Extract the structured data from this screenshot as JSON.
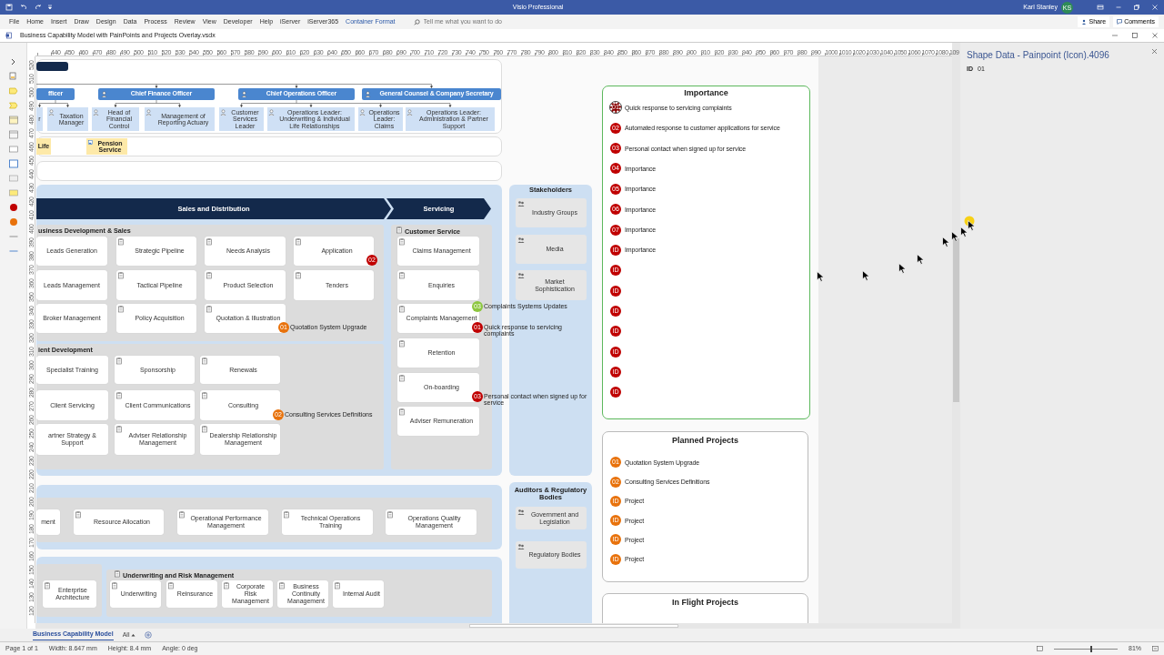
{
  "title_bar": {
    "app_title": "Visio Professional",
    "user_name": "Karl Stanley",
    "user_initials": "KS"
  },
  "ribbon_tabs": [
    {
      "label": "File",
      "kind": "tab"
    },
    {
      "label": "Home",
      "kind": "tab"
    },
    {
      "label": "Insert",
      "kind": "tab"
    },
    {
      "label": "Draw",
      "kind": "tab"
    },
    {
      "label": "Design",
      "kind": "tab"
    },
    {
      "label": "Data",
      "kind": "tab"
    },
    {
      "label": "Process",
      "kind": "tab"
    },
    {
      "label": "Review",
      "kind": "tab"
    },
    {
      "label": "View",
      "kind": "tab"
    },
    {
      "label": "Developer",
      "kind": "tab"
    },
    {
      "label": "Help",
      "kind": "tab"
    },
    {
      "label": "iServer",
      "kind": "tab"
    },
    {
      "label": "iServer365",
      "kind": "tab"
    },
    {
      "label": "Container Format",
      "kind": "contextual"
    }
  ],
  "search": {
    "placeholder": "Tell me what you want to do"
  },
  "share_label": "Share",
  "comments_label": "Comments",
  "document": {
    "title": "Business Capability Model with PainPoints and Projects Overlay.vsdx"
  },
  "rulers": {
    "horizontal": [
      "440",
      "450",
      "460",
      "470",
      "480",
      "490",
      "500",
      "510",
      "520",
      "530",
      "540",
      "550",
      "560",
      "570",
      "580",
      "590",
      "600",
      "610",
      "620",
      "630",
      "640",
      "650",
      "660",
      "670",
      "680",
      "690",
      "700",
      "710",
      "720",
      "730",
      "740",
      "750",
      "760",
      "770",
      "780",
      "790",
      "800",
      "810",
      "820",
      "830",
      "840",
      "850",
      "860",
      "870",
      "880",
      "890",
      "900",
      "910",
      "920",
      "930",
      "940",
      "950",
      "960",
      "970",
      "980",
      "990",
      "1000",
      "1010",
      "1020",
      "1030",
      "1040",
      "1050",
      "1060",
      "1070",
      "1080",
      "109"
    ],
    "vertical": [
      "520",
      "510",
      "500",
      "490",
      "480",
      "470",
      "460",
      "450",
      "440",
      "430",
      "420",
      "410",
      "400",
      "390",
      "380",
      "370",
      "360",
      "350",
      "340",
      "330",
      "320",
      "310",
      "300",
      "290",
      "280",
      "270",
      "260",
      "250",
      "240",
      "230",
      "220",
      "210",
      "200",
      "190",
      "180",
      "170",
      "160",
      "150",
      "140",
      "130",
      "120"
    ]
  },
  "diagram": {
    "org_chart": {
      "executives": [
        {
          "label": "fficer"
        },
        {
          "label": "Chief Finance Officer"
        },
        {
          "label": "Chief Operations Officer"
        },
        {
          "label": "General Counsel & Company Secretary"
        }
      ],
      "reports": [
        {
          "label": "r"
        },
        {
          "label": "Taxation Manager"
        },
        {
          "label": "Head of Financial Control"
        },
        {
          "label": "Management of Reporting Actuary"
        },
        {
          "label": "Customer Services Leader"
        },
        {
          "label": "Operations Leader: Underwriting & Individual Life Relationships"
        },
        {
          "label": "Operations Leader: Claims"
        },
        {
          "label": "Operations Leader: Administration & Partner Support"
        }
      ]
    },
    "products": [
      {
        "label": "Life"
      },
      {
        "label": "Pension Service"
      }
    ],
    "value_stages": [
      {
        "label": "Sales and Distribution"
      },
      {
        "label": "Servicing"
      }
    ],
    "capability_groups": [
      {
        "title": "usiness Development & Sales",
        "capabilities": [
          {
            "label": "Leads Generation"
          },
          {
            "label": "Strategic Pipeline"
          },
          {
            "label": "Needs Analysis"
          },
          {
            "label": "Application",
            "painpoints": [
              {
                "id": "02",
                "color": "#c00000"
              }
            ]
          },
          {
            "label": "Leads Management"
          },
          {
            "label": "Tactical Pipeline"
          },
          {
            "label": "Product Selection"
          },
          {
            "label": "Tenders"
          },
          {
            "label": "Broker Management"
          },
          {
            "label": "Policy Acquisition"
          },
          {
            "label": "Quotation & Illustration",
            "painpoints": [
              {
                "id": "01",
                "color": "#e8720c",
                "note": "Quotation System Upgrade"
              }
            ]
          }
        ]
      },
      {
        "title": "ient Development",
        "capabilities": [
          {
            "label": "Specialist Training"
          },
          {
            "label": "Sponsorship"
          },
          {
            "label": "Renewals"
          },
          {
            "label": "Client Servicing"
          },
          {
            "label": "Client Communications"
          },
          {
            "label": "Consulting",
            "painpoints": [
              {
                "id": "02",
                "color": "#e8720c",
                "note": "Consulting Services Definitions"
              }
            ]
          },
          {
            "label": "artner Strategy & Support"
          },
          {
            "label": "Adviser Relationship Management"
          },
          {
            "label": "Dealership Relationship Management"
          }
        ]
      },
      {
        "title": "Customer Service",
        "capabilities": [
          {
            "label": "Claims Management"
          },
          {
            "label": "Enquiries"
          },
          {
            "label": "Complaints Management",
            "painpoints": [
              {
                "id": "03",
                "color": "#8dc63f",
                "note": "Complaints Systems Updates"
              },
              {
                "id": "01",
                "color": "#c00000",
                "note": "Quick response to servicing complaints"
              }
            ]
          },
          {
            "label": "Retention"
          },
          {
            "label": "On-boarding",
            "painpoints": [
              {
                "id": "03",
                "color": "#c00000",
                "note": "Personal contact when signed up for service"
              }
            ]
          },
          {
            "label": "Adviser Remuneration"
          }
        ]
      },
      {
        "capabilities": [
          {
            "label": "ment"
          },
          {
            "label": "Resource Allocation"
          },
          {
            "label": "Operational Performance Management"
          },
          {
            "label": "Technical Operations Training"
          },
          {
            "label": "Operations Quality Management"
          }
        ]
      },
      {
        "capabilities": [
          {
            "label": "Enterprise Architecture"
          }
        ]
      },
      {
        "title": "Underwriting and Risk Management",
        "capabilities": [
          {
            "label": "Underwriting"
          },
          {
            "label": "Reinsurance"
          },
          {
            "label": "Corporate Risk Management"
          },
          {
            "label": "Business Continuity Management"
          },
          {
            "label": "Internal Audit"
          }
        ]
      }
    ],
    "stakeholder_columns": [
      {
        "title": "Stakeholders",
        "items": [
          {
            "label": "Industry Groups"
          },
          {
            "label": "Media"
          },
          {
            "label": "Market Sophistication"
          }
        ]
      },
      {
        "title": "Auditors & Regulatory Bodies",
        "items": [
          {
            "label": "Government and Legislation"
          },
          {
            "label": "Regulatory Bodies"
          }
        ]
      }
    ],
    "importance": {
      "title": "Importance",
      "items": [
        {
          "id": "01",
          "label": "Quick response to servicing complaints",
          "selected": true
        },
        {
          "id": "02",
          "label": "Automated response to customer applications for service",
          "selected": false
        },
        {
          "id": "03",
          "label": "Personal contact when signed up for service",
          "selected": false
        },
        {
          "id": "04",
          "label": "Importance",
          "selected": false
        },
        {
          "id": "05",
          "label": "Importance",
          "selected": false
        },
        {
          "id": "06",
          "label": "Importance",
          "selected": false
        },
        {
          "id": "07",
          "label": "Importance",
          "selected": false
        },
        {
          "id": "ID",
          "label": "Importance",
          "selected": false
        },
        {
          "id": "ID",
          "selected": false
        },
        {
          "id": "ID",
          "selected": false
        },
        {
          "id": "ID",
          "selected": false
        },
        {
          "id": "ID",
          "selected": false
        },
        {
          "id": "ID",
          "selected": false
        },
        {
          "id": "ID",
          "selected": false
        },
        {
          "id": "ID",
          "selected": false
        }
      ]
    },
    "planned_projects": {
      "title": "Planned Projects",
      "items": [
        {
          "id": "01",
          "label": "Quotation System Upgrade"
        },
        {
          "id": "02",
          "label": "Consulting Services Definitions"
        },
        {
          "id": "ID",
          "label": "Project"
        },
        {
          "id": "ID",
          "label": "Project"
        },
        {
          "id": "ID",
          "label": "Project"
        },
        {
          "id": "ID",
          "label": "Project"
        }
      ]
    },
    "in_flight_projects": {
      "title": "In Flight Projects"
    }
  },
  "shape_data": {
    "title": "Shape Data - Painpoint (Icon).4096",
    "fields": [
      {
        "label": "ID",
        "value": "01"
      }
    ]
  },
  "sheet_tabs": [
    {
      "label": "Business Capability Model",
      "selected": true
    }
  ],
  "sheet_filter": "All",
  "status_bar": {
    "page": "Page 1 of 1",
    "width": "Width: 8.647 mm",
    "height": "Height: 8.4 mm",
    "angle": "Angle: 0 deg",
    "zoom": "81%",
    "zoom_slider": {
      "level": 0.57
    }
  }
}
